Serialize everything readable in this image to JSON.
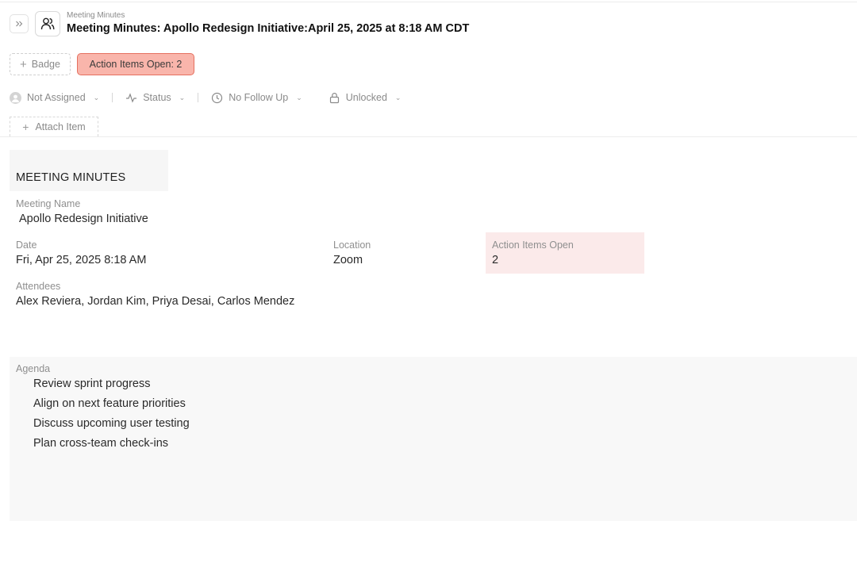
{
  "header": {
    "breadcrumb": "Meeting Minutes",
    "title": "Meeting Minutes: Apollo Redesign Initiative:April 25, 2025 at 8:18 AM CDT",
    "expand_icon": "double-chevron-right-icon",
    "type_icon": "users-icon"
  },
  "badges": {
    "add_label": "Badge",
    "alert_label": "Action Items Open: 2",
    "alert_color": "#f9b5ab"
  },
  "properties": {
    "assignee": "Not Assigned",
    "status": "Status",
    "follow_up": "No Follow Up",
    "lock": "Unlocked"
  },
  "attach": {
    "label": "Attach Item"
  },
  "record": {
    "section_title": "MEETING MINUTES",
    "meeting_name": {
      "label": "Meeting Name",
      "value": "Apollo Redesign Initiative"
    },
    "date": {
      "label": "Date",
      "value": "Fri, Apr 25, 2025 8:18 AM"
    },
    "location": {
      "label": "Location",
      "value": "Zoom"
    },
    "action_items_open": {
      "label": "Action Items Open",
      "value": "2"
    },
    "attendees": {
      "label": "Attendees",
      "value": "Alex Reviera, Jordan Kim, Priya Desai, Carlos Mendez"
    },
    "agenda": {
      "label": "Agenda",
      "items": [
        "Review sprint progress",
        "Align on next feature priorities",
        "Discuss upcoming user testing",
        "Plan cross-team check-ins"
      ]
    }
  }
}
